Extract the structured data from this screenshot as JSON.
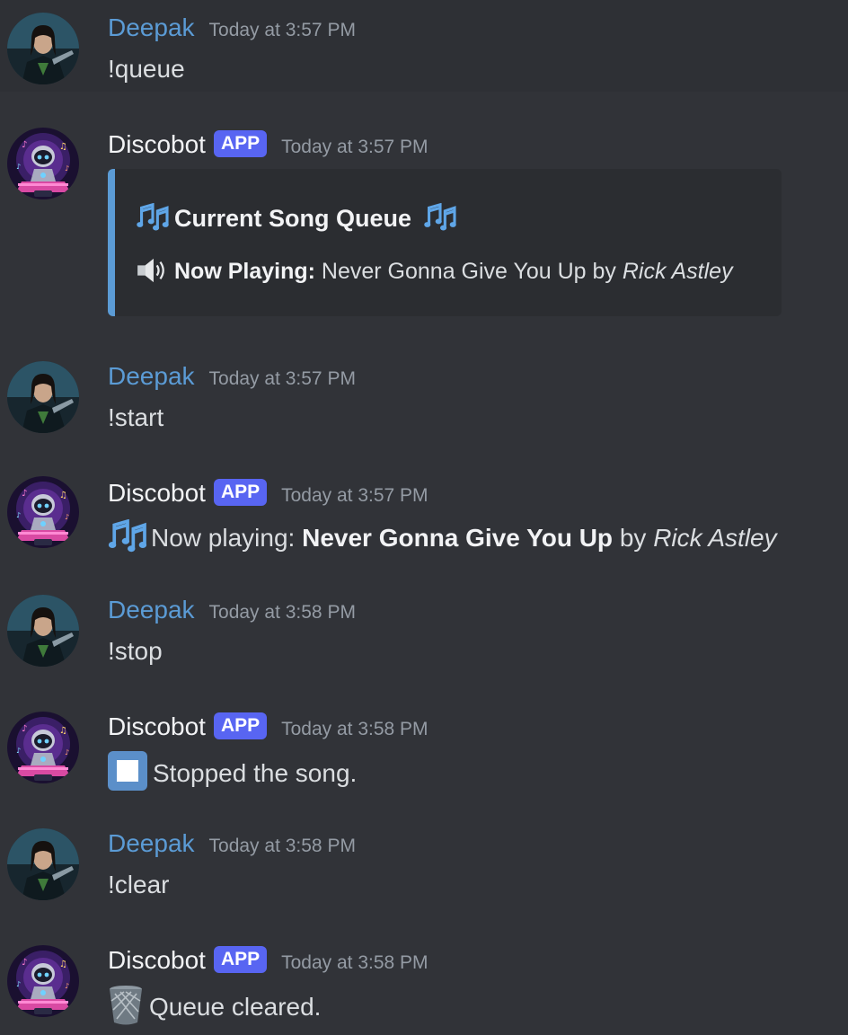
{
  "messages": [
    {
      "author": "Deepak",
      "timestamp": "Today at 3:57 PM",
      "text": "!queue"
    },
    {
      "author": "Discobot",
      "tag": "APP",
      "timestamp": "Today at 3:57 PM",
      "embed": {
        "title": "Current Song Queue",
        "now_playing_label": "Now Playing:",
        "song": "Never Gonna Give You Up",
        "by": "by",
        "artist": "Rick Astley"
      }
    },
    {
      "author": "Deepak",
      "timestamp": "Today at 3:57 PM",
      "text": "!start"
    },
    {
      "author": "Discobot",
      "tag": "APP",
      "timestamp": "Today at 3:57 PM",
      "prefix": "Now playing:",
      "song": "Never Gonna Give You Up",
      "by": "by",
      "artist": "Rick Astley"
    },
    {
      "author": "Deepak",
      "timestamp": "Today at 3:58 PM",
      "text": "!stop"
    },
    {
      "author": "Discobot",
      "tag": "APP",
      "timestamp": "Today at 3:58 PM",
      "text": "Stopped the song."
    },
    {
      "author": "Deepak",
      "timestamp": "Today at 3:58 PM",
      "text": "!clear"
    },
    {
      "author": "Discobot",
      "tag": "APP",
      "timestamp": "Today at 3:58 PM",
      "text": "Queue cleared."
    }
  ],
  "icons": {
    "notes": "musical-notes-icon",
    "speaker": "speaker-icon",
    "stop": "stop-button-icon",
    "trash": "wastebasket-icon"
  },
  "colors": {
    "background": "#313338",
    "user_name": "#5b9bd5",
    "app_tag": "#5865f2",
    "embed_bar": "#5b9bd5",
    "embed_bg": "#2b2d31",
    "timestamp": "#949ba4"
  }
}
